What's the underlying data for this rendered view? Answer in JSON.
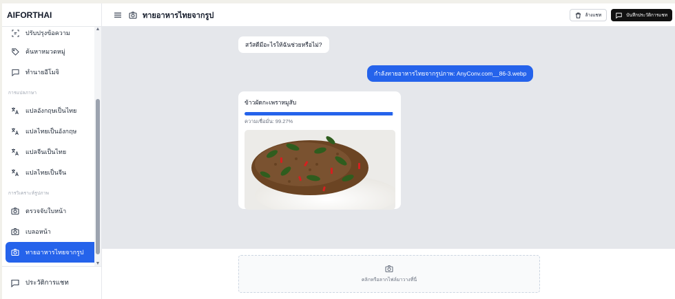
{
  "app": {
    "name": "AIFORTHAI"
  },
  "sidebar": {
    "top_items": [
      {
        "label": "ปรับปรุงข้อความ",
        "icon": "scan-text-icon"
      },
      {
        "label": "ค้นหาหมวดหมู่",
        "icon": "tag-icon"
      },
      {
        "label": "ทำนายอีโมจิ",
        "icon": "chat-icon"
      }
    ],
    "sections": [
      {
        "label": "การแปลภาษา",
        "items": [
          {
            "label": "แปลอังกฤษเป็นไทย",
            "icon": "translate-icon"
          },
          {
            "label": "แปลไทยเป็นอังกฤษ",
            "icon": "translate-icon"
          },
          {
            "label": "แปลจีนเป็นไทย",
            "icon": "translate-icon"
          },
          {
            "label": "แปลไทยเป็นจีน",
            "icon": "translate-icon"
          }
        ]
      },
      {
        "label": "การวิเคราะห์รูปภาพ",
        "items": [
          {
            "label": "ตรวจจับใบหน้า",
            "icon": "camera-icon"
          },
          {
            "label": "เบลอหน้า",
            "icon": "camera-icon"
          },
          {
            "label": "ทายอาหารไทยจากรูป",
            "icon": "camera-icon",
            "active": true
          }
        ]
      }
    ],
    "footer": {
      "label": "ประวัติการแชท",
      "icon": "chat-icon"
    }
  },
  "header": {
    "title": "ทายอาหารไทยจากรูป",
    "clear_label": "ล้างแชท",
    "save_label": "บันทึกประวัติการแชท"
  },
  "chat": {
    "bot_greeting": "สวัสดีมีอะไรให้ฉันช่วยหรือไม่?",
    "user_message": "กำลังทายอาหารไทยจากรูปภาพ: AnyConv.com__86-3.webp",
    "result": {
      "dish_name": "ข้าวผัดกะเพราหมูสับ",
      "confidence_text": "ความเชื่อมั่น: 99.27%",
      "confidence": 0.9927
    }
  },
  "upload": {
    "text": "คลิกหรือลากไฟล์มาวางที่นี่"
  },
  "colors": {
    "accent": "#2563eb",
    "chat_bg": "#e5e7eb",
    "dark_button": "#111111"
  }
}
